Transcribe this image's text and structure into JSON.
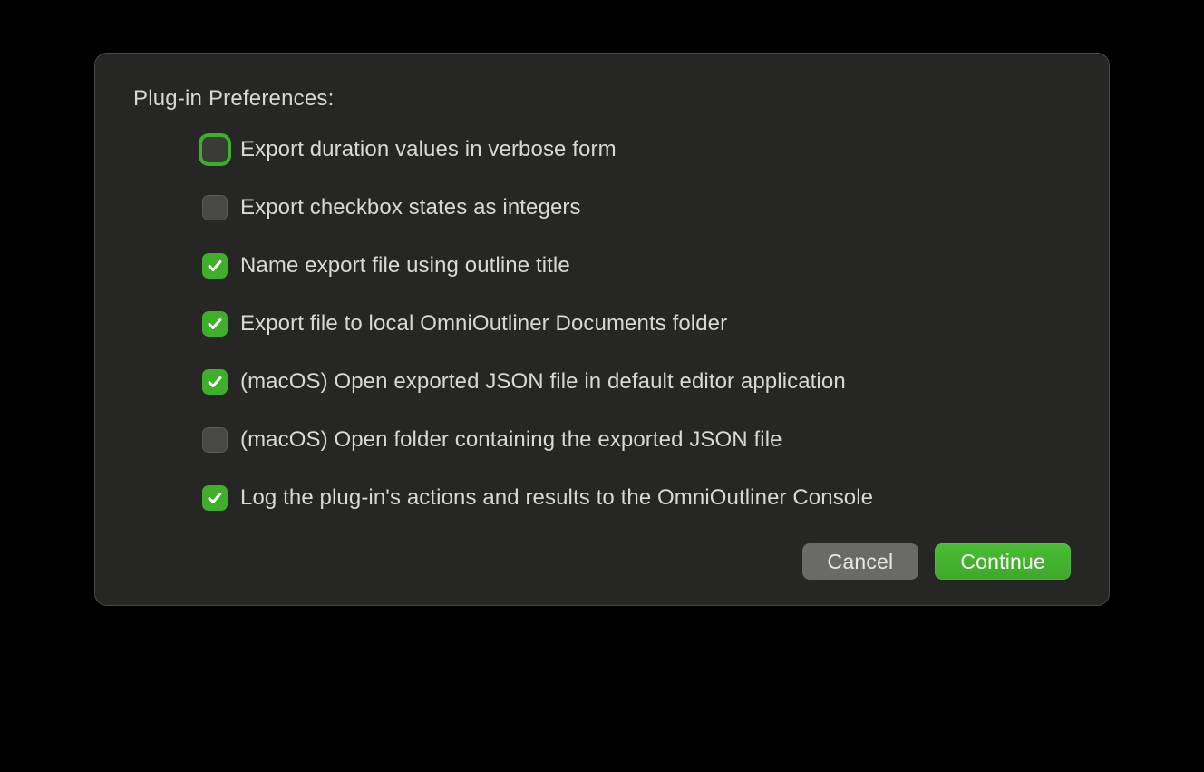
{
  "title": "Plug-in Preferences:",
  "options": [
    {
      "label": "Export duration values in verbose form",
      "checked": false,
      "focused": true
    },
    {
      "label": "Export checkbox states as integers",
      "checked": false,
      "focused": false
    },
    {
      "label": "Name export file using outline title",
      "checked": true,
      "focused": false
    },
    {
      "label": "Export file to local OmniOutliner Documents folder",
      "checked": true,
      "focused": false
    },
    {
      "label": "(macOS) Open exported JSON file in default editor application",
      "checked": true,
      "focused": false
    },
    {
      "label": "(macOS) Open folder containing the exported JSON file",
      "checked": false,
      "focused": false
    },
    {
      "label": "Log the plug-in's actions and results to the OmniOutliner Console",
      "checked": true,
      "focused": false
    }
  ],
  "buttons": {
    "cancel": "Cancel",
    "continue": "Continue"
  }
}
